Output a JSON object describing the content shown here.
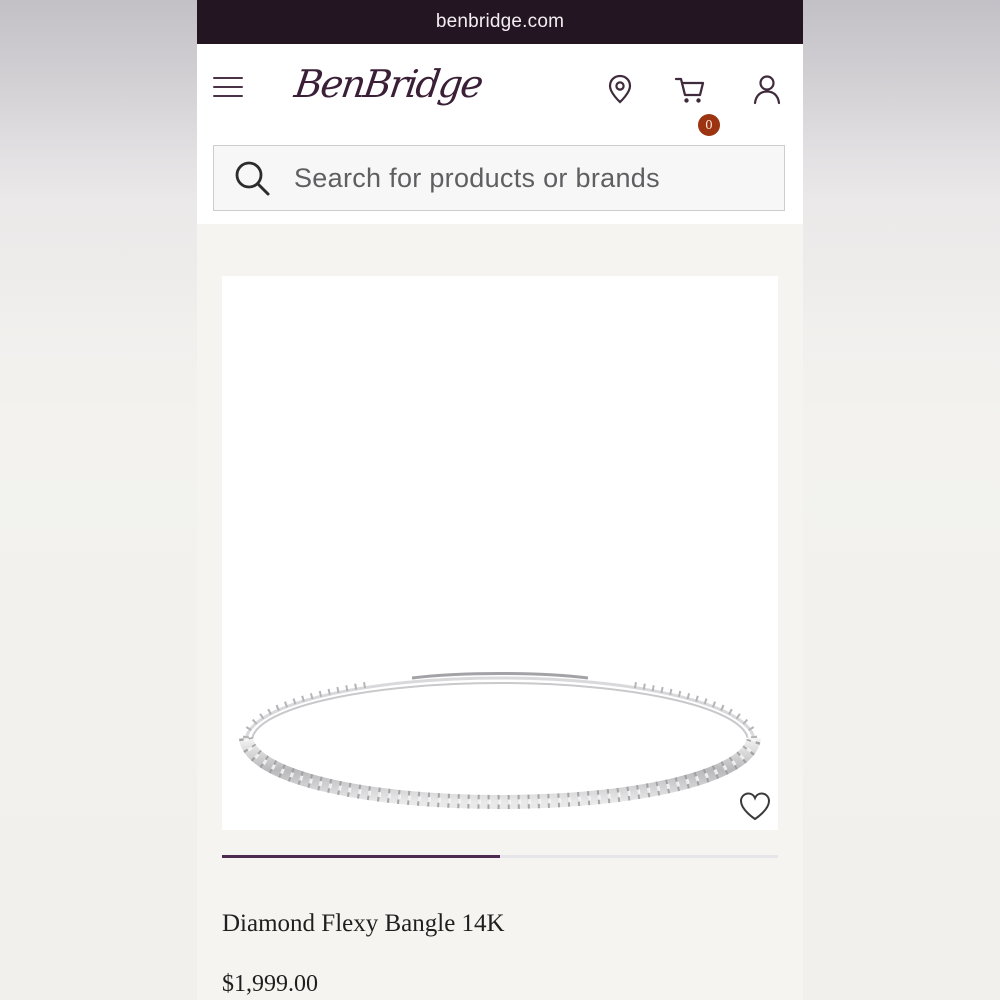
{
  "browser": {
    "url": "benbridge.com"
  },
  "header": {
    "logo_text": "BenBridge",
    "cart_count": "0",
    "icons": [
      "menu-icon",
      "location-pin-icon",
      "cart-icon",
      "user-icon"
    ]
  },
  "search": {
    "placeholder": "Search for products or brands"
  },
  "product": {
    "title": "Diamond Flexy Bangle 14K",
    "price": "$1,999.00",
    "image_alt": "Diamond Flexy Bangle 14K",
    "carousel_progress": 0.5
  },
  "colors": {
    "url_bar": "#231521",
    "brand": "#3a1f36",
    "cart_badge": "#9c3412",
    "carousel_active": "#4e2a52"
  }
}
